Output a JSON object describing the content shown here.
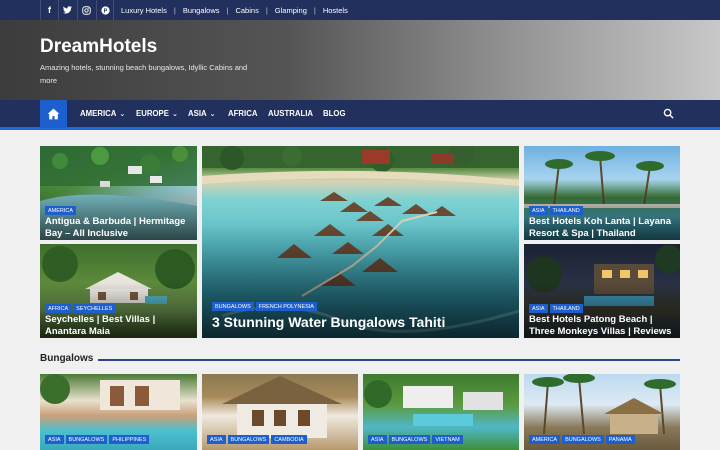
{
  "topbar": {
    "social": [
      {
        "name": "facebook-icon",
        "glyph": "f"
      },
      {
        "name": "twitter-icon",
        "glyph": "t"
      },
      {
        "name": "instagram-icon",
        "glyph": "◎"
      },
      {
        "name": "pinterest-icon",
        "glyph": "P"
      }
    ],
    "links": [
      "Luxury Hotels",
      "Bungalows",
      "Cabins",
      "Glamping",
      "Hostels"
    ]
  },
  "header": {
    "title": "DreamHotels",
    "tagline": "Amazing hotels, stunning beach bungalows, Idyllic Cabins and more"
  },
  "nav": {
    "items": [
      {
        "label": "AMERICA",
        "dropdown": true
      },
      {
        "label": "EUROPE",
        "dropdown": true
      },
      {
        "label": "ASIA",
        "dropdown": true
      },
      {
        "label": "AFRICA",
        "dropdown": false
      },
      {
        "label": "AUSTRALIA",
        "dropdown": false
      },
      {
        "label": "BLOG",
        "dropdown": false
      }
    ]
  },
  "featured": [
    {
      "tags": [
        "AMERICA"
      ],
      "title": "Antigua & Barbuda | Hermitage Bay – All Inclusive"
    },
    {
      "tags": [
        "AFRICA",
        "SEYCHELLES"
      ],
      "title": "Seychelles | Best Villas | Anantara Maia"
    },
    {
      "tags": [
        "BUNGALOWS",
        "FRENCH POLYNESIA"
      ],
      "title": "3 Stunning Water Bungalows Tahiti"
    },
    {
      "tags": [
        "ASIA",
        "THAILAND"
      ],
      "title": "Best Hotels Koh Lanta | Layana Resort & Spa | Thailand"
    },
    {
      "tags": [
        "ASIA",
        "THAILAND"
      ],
      "title": "Best Hotels Patong Beach | Three Monkeys Villas | Reviews"
    }
  ],
  "section": {
    "title": "Bungalows"
  },
  "bungalows": [
    {
      "tags": [
        "ASIA",
        "BUNGALOWS",
        "PHILIPPINES"
      ]
    },
    {
      "tags": [
        "ASIA",
        "BUNGALOWS",
        "CAMBODIA"
      ]
    },
    {
      "tags": [
        "ASIA",
        "BUNGALOWS",
        "VIETNAM"
      ]
    },
    {
      "tags": [
        "AMERICA",
        "BUNGALOWS",
        "PANAMA"
      ]
    }
  ],
  "colors": {
    "navy": "#22305d",
    "accent": "#1e5fce",
    "tag": "#1e5fce"
  }
}
